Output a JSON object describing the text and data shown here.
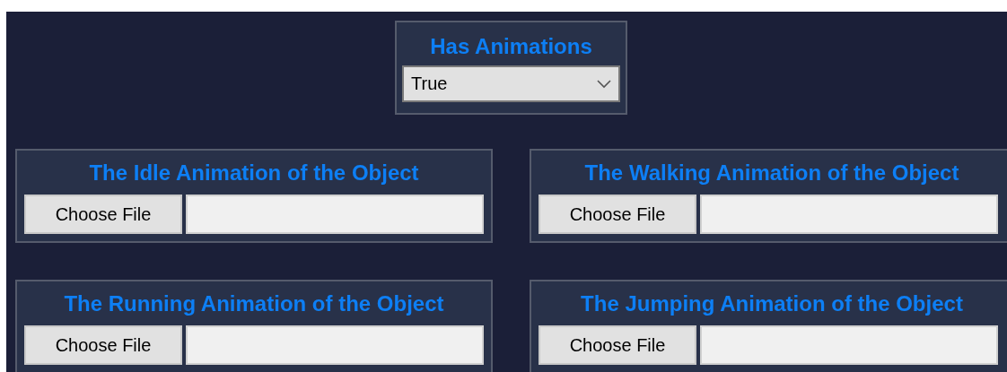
{
  "has_animations": {
    "label": "Has Animations",
    "value": "True"
  },
  "file_pickers": [
    {
      "title": "The Idle Animation of the Object",
      "button": "Choose File"
    },
    {
      "title": "The Walking Animation of the Object",
      "button": "Choose File"
    },
    {
      "title": "The Running Animation of the Object",
      "button": "Choose File"
    },
    {
      "title": "The Jumping Animation of the Object",
      "button": "Choose File"
    }
  ]
}
